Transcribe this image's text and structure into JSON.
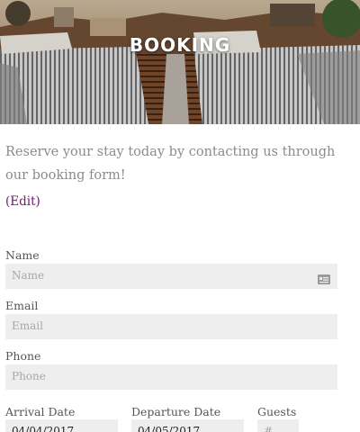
{
  "hero": {
    "title": "BOOKING"
  },
  "intro": {
    "text": "Reserve your stay today by contacting us through our booking form!"
  },
  "edit_link": "(Edit)",
  "form": {
    "name": {
      "label": "Name",
      "placeholder": "Name"
    },
    "email": {
      "label": "Email",
      "placeholder": "Email"
    },
    "phone": {
      "label": "Phone",
      "placeholder": "Phone"
    },
    "arrival": {
      "label": "Arrival Date",
      "value": "04/04/2017"
    },
    "departure": {
      "label": "Departure Date",
      "value": "04/05/2017"
    },
    "guests": {
      "label": "Guests",
      "placeholder": "#"
    }
  },
  "colors": {
    "link": "#6a1b6a",
    "field_bg": "#eeeeee",
    "muted_text": "#8b8b8b"
  },
  "icons": [
    "contact-card-icon",
    "calendar-icon"
  ]
}
